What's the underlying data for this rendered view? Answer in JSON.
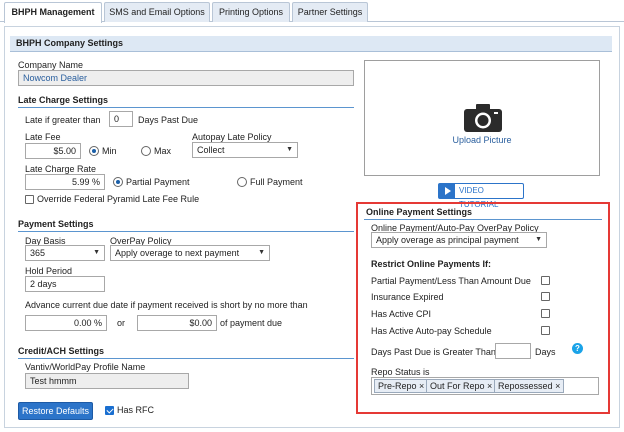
{
  "tabs": [
    "BHPH Management",
    "SMS and Email Options",
    "Printing Options",
    "Partner Settings"
  ],
  "section_title": "BHPH Company Settings",
  "company": {
    "label": "Company Name",
    "value": "Nowcom Dealer"
  },
  "late_charge": {
    "heading": "Late Charge Settings",
    "late_if_label": "Late if greater than",
    "late_if_value": "0",
    "days_past_due": "Days Past Due",
    "late_fee_label": "Late Fee",
    "late_fee_value": "$5.00",
    "min_label": "Min",
    "max_label": "Max",
    "autopay_label": "Autopay Late Policy",
    "autopay_value": "Collect",
    "rate_label": "Late Charge Rate",
    "rate_value": "5.99 %",
    "partial_label": "Partial Payment",
    "full_label": "Full Payment",
    "override_label": "Override Federal Pyramid Late Fee Rule"
  },
  "payment": {
    "heading": "Payment Settings",
    "day_basis_label": "Day Basis",
    "day_basis_value": "365",
    "overpay_label": "OverPay Policy",
    "overpay_value": "Apply overage to next payment",
    "hold_label": "Hold Period",
    "hold_value": "2 days",
    "advance_label": "Advance current due date if payment received is short by no more than",
    "pct_value": "0.00 %",
    "or_label": "or",
    "amt_value": "$0.00",
    "of_payment_due": "of payment due"
  },
  "credit": {
    "heading": "Credit/ACH Settings",
    "profile_label": "Vantiv/WorldPay Profile Name",
    "profile_value": "Test hmmm"
  },
  "footer": {
    "restore_label": "Restore Defaults",
    "has_rfc_label": "Has RFC"
  },
  "picture": {
    "upload_label": "Upload Picture",
    "video_label": "VIDEO TUTORIAL"
  },
  "online": {
    "heading": "Online Payment Settings",
    "policy_label": "Online Payment/Auto-Pay OverPay Policy",
    "policy_value": "Apply overage as principal payment",
    "restrict_heading": "Restrict Online Payments If:",
    "options": [
      "Partial Payment/Less Than Amount Due",
      "Insurance Expired",
      "Has Active CPI",
      "Has Active Auto-pay Schedule"
    ],
    "days_label": "Days Past Due is Greater Than",
    "days_unit": "Days",
    "repo_label": "Repo Status is",
    "repo_tags": [
      "Pre-Repo",
      "Out For Repo",
      "Repossessed"
    ]
  },
  "colors": {
    "accent": "#2c74c9",
    "highlight": "#e53935",
    "section_bg": "#dde8f4"
  }
}
